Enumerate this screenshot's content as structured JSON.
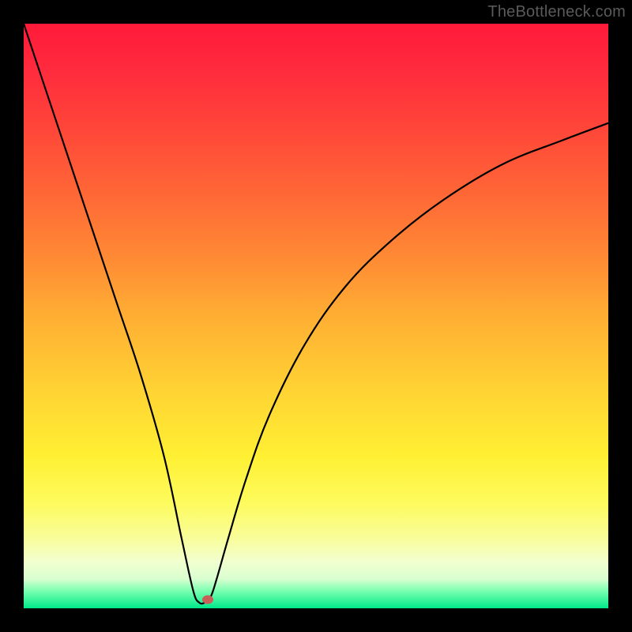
{
  "watermark": "TheBottleneck.com",
  "chart_data": {
    "type": "line",
    "title": "",
    "xlabel": "",
    "ylabel": "",
    "xlim": [
      0,
      100
    ],
    "ylim": [
      0,
      100
    ],
    "grid": false,
    "series": [
      {
        "name": "bottleneck-curve",
        "x": [
          0,
          4,
          8,
          12,
          16,
          20,
          24,
          27,
          29,
          30,
          31,
          32,
          33,
          35,
          38,
          42,
          48,
          55,
          63,
          72,
          82,
          92,
          100
        ],
        "y": [
          100,
          88,
          76,
          64,
          52,
          40,
          26,
          12,
          3,
          1,
          1,
          2,
          5,
          12,
          22,
          33,
          45,
          55,
          63,
          70,
          76,
          80,
          83
        ]
      }
    ],
    "marker": {
      "x": 31.5,
      "y": 1.5,
      "color": "#c86058"
    },
    "gradient_stops": [
      {
        "pct": 0,
        "color": "#ff1a3a"
      },
      {
        "pct": 50,
        "color": "#ffae33"
      },
      {
        "pct": 82,
        "color": "#fdfb5e"
      },
      {
        "pct": 100,
        "color": "#00e88a"
      }
    ]
  }
}
